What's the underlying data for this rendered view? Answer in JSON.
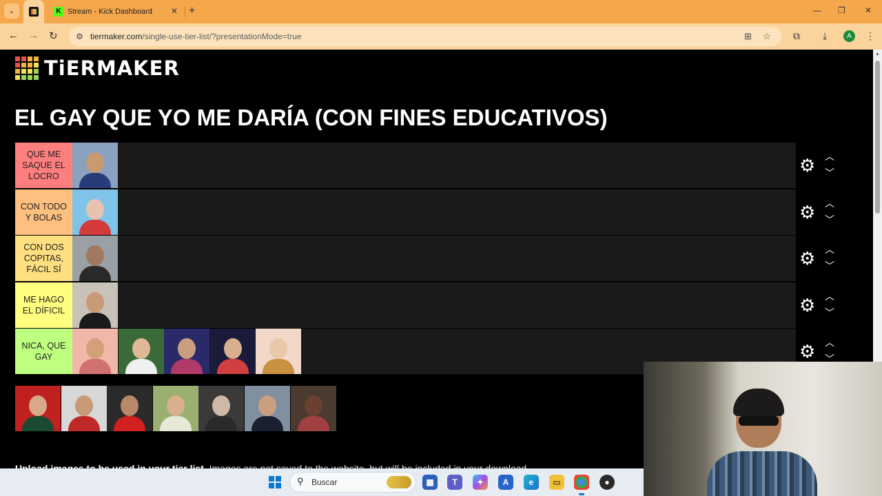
{
  "browser": {
    "tab_menu_icon": "chevron-down",
    "tabs": [
      {
        "title": "",
        "favicon": "tiermaker"
      },
      {
        "title": "Stream - Kick Dashboard",
        "favicon": "kick"
      }
    ],
    "new_tab_symbol": "+",
    "close_symbol": "✕",
    "url_host": "tiermaker.com",
    "url_path": "/single-use-tier-list/?presentationMode=true",
    "profile_initial": "A",
    "window_controls": [
      "—",
      "❐",
      "✕"
    ]
  },
  "page": {
    "logo_text": "TiERMAKER",
    "title": "EL GAY QUE YO ME DARÍA (CON FINES EDUCATIVOS)",
    "tiers": [
      {
        "label": "QUE ME SAQUE EL LOCRO",
        "color": "#ff7f7f",
        "items": [
          {
            "face": "#c9996f",
            "body": "#283c7a",
            "bg": "#8aa2c0"
          }
        ]
      },
      {
        "label": "CON TODO Y BOLAS",
        "color": "#ffbf7f",
        "items": [
          {
            "face": "#e8c2b0",
            "body": "#d43a3a",
            "bg": "#7fc4e8"
          }
        ]
      },
      {
        "label": "CON DOS COPITAS, FÁCIL SÍ",
        "color": "#ffdf7f",
        "items": [
          {
            "face": "#a07a60",
            "body": "#2a2a2a",
            "bg": "#9aa0a6"
          }
        ]
      },
      {
        "label": "ME HAGO EL DÍFICIL",
        "color": "#ffff7f",
        "items": [
          {
            "face": "#c99a78",
            "body": "#1a1a1a",
            "bg": "#c8c2b8"
          }
        ]
      },
      {
        "label": "NICA, QUE GAY",
        "color": "#bfff7f",
        "items": [
          {
            "face": "#d4a07a",
            "body": "#d07070",
            "bg": "#f0b8a8"
          },
          {
            "face": "#e0b898",
            "body": "#f0f0f0",
            "bg": "#3a6a3a"
          },
          {
            "face": "#c8a080",
            "body": "#b03a6a",
            "bg": "#2a2a6a"
          },
          {
            "face": "#d8b090",
            "body": "#d04040",
            "bg": "#1a1a3a"
          },
          {
            "face": "#e8c8a8",
            "body": "#c89040",
            "bg": "#f2d8c8"
          }
        ]
      }
    ],
    "pool": [
      {
        "face": "#d8a888",
        "body": "#1a4a30",
        "bg": "#c02020"
      },
      {
        "face": "#c89a78",
        "body": "#c02828",
        "bg": "#d8d8d8"
      },
      {
        "face": "#b88868",
        "body": "#d02020",
        "bg": "#2a2a2a"
      },
      {
        "face": "#d8b090",
        "body": "#e8e8d8",
        "bg": "#9ab070"
      },
      {
        "face": "#d0b8a8",
        "body": "#2a2a2a",
        "bg": "#3a3a3a"
      },
      {
        "face": "#c8a080",
        "body": "#1a2030",
        "bg": "#8090a0"
      },
      {
        "face": "#6a4030",
        "body": "#a04040",
        "bg": "#4a3a30"
      }
    ],
    "upload_bold": "Upload images to be used in your tier list.",
    "upload_rest": " Images are not saved to the website, but will be included in your download."
  },
  "taskbar": {
    "search_label": "Buscar",
    "apps": [
      "store",
      "teams",
      "copilot",
      "editor",
      "edge",
      "files",
      "chrome",
      "obs"
    ]
  },
  "colors": {
    "tab_bar": "#f5a74b",
    "address_bar": "#fbd49d",
    "page_bg": "#000000",
    "tier_row_bg": "#1a1a1a"
  }
}
